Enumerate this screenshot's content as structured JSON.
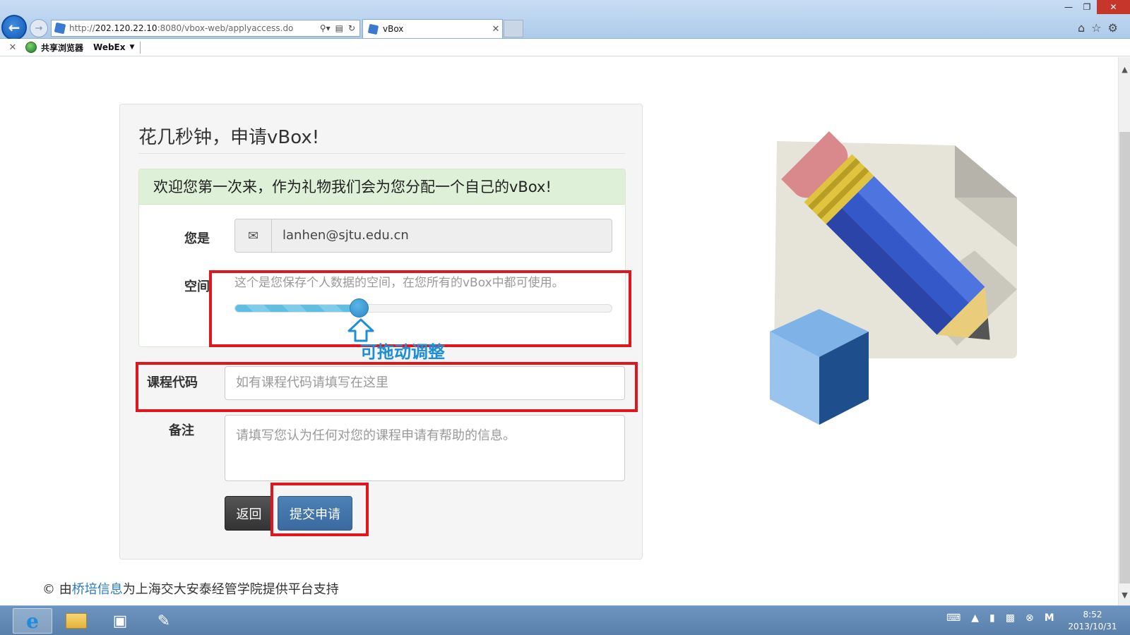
{
  "browser": {
    "url_prefix": "http://",
    "url_host": "202.120.22.10",
    "url_rest": ":8080/vbox-web/applyaccess.do",
    "tab_title": "vBox",
    "favorites": [
      {
        "label": "共享浏览器"
      },
      {
        "label": "WebEx"
      }
    ]
  },
  "form": {
    "title": "花几秒钟，申请vBox!",
    "welcome": "欢迎您第一次来，作为礼物我们会为您分配一个自己的vBox!",
    "label_you_are": "您是",
    "email": "lanhen@sjtu.edu.cn",
    "label_space": "空间",
    "space_help": "这个是您保存个人数据的空间，在您所有的vBox中都可使用。",
    "space_slider_fraction": 0.33,
    "label_course_code": "课程代码",
    "course_code_placeholder": "如有课程代码请填写在这里",
    "label_remark": "备注",
    "remark_placeholder": "请填写您认为任何对您的课程申请有帮助的信息。",
    "btn_back": "返回",
    "btn_submit": "提交申请"
  },
  "annotation": {
    "drag_hint": "可拖动调整",
    "box_color": "#e0161f",
    "hint_color": "#1e8fd6"
  },
  "footer": {
    "prefix": "© 由",
    "link": "桥培信息",
    "suffix": "为上海交大安泰经管学院提供平台支持"
  },
  "taskbar": {
    "time": "8:52",
    "date": "2013/10/31"
  },
  "icons": [
    "back-arrow-icon",
    "forward-arrow-icon",
    "search-icon",
    "refresh-icon",
    "home-icon",
    "star-icon",
    "gear-icon",
    "envelope-icon",
    "ie-icon",
    "folder-icon",
    "keyboard-icon"
  ]
}
